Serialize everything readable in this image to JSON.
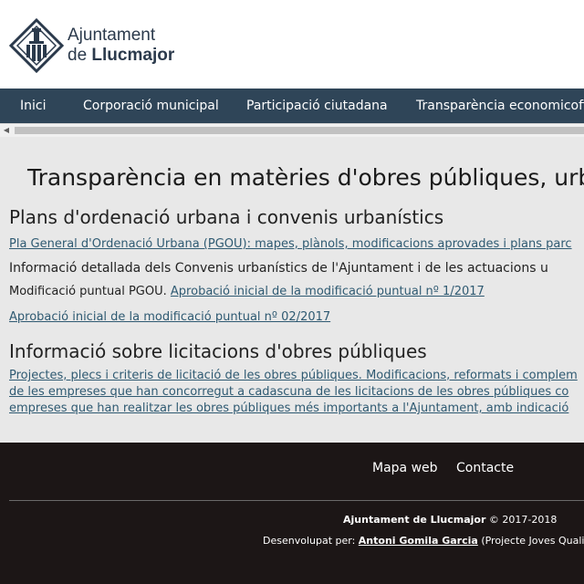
{
  "header": {
    "logo_line1": "Ajuntament",
    "logo_line2_prefix": "de ",
    "logo_line2_bold": "Llucmajor"
  },
  "nav": {
    "items": [
      {
        "label": "Inici"
      },
      {
        "label": "Corporació municipal"
      },
      {
        "label": "Participació ciutadana"
      },
      {
        "label": "Transparència economicofin"
      }
    ]
  },
  "main": {
    "page_title": "Transparència en matèries d'obres públiques, urb",
    "section1": {
      "title": "Plans d'ordenació urbana i convenis urbanístics",
      "link_pgou": "Pla General d'Ordenació Urbana (PGOU): mapes, plànols, modificacions aprovades i plans parc",
      "convenis_text": "Informació detallada dels Convenis urbanístics de l'Ajuntament i de les actuacions u",
      "mod_label": "Modificació puntual PGOU.",
      "mod_link_1": "Aprobació inicial de la modificació puntual nº 1/2017",
      "mod_link_2": "Aprobació inicial de la modificació puntual nº 02/2017"
    },
    "section2": {
      "title": "Informació sobre licitacions d'obres públiques",
      "line1": "Projectes, plecs i criteris de licitació de les obres públiques. Modificacions, reformats i complem",
      "line2": "de les empreses que han concorregut a cadascuna de les licitacions de les obres públiques co",
      "line3": "empreses que han realitzar les obres públiques més importants a l'Ajuntament, amb indicació"
    }
  },
  "footer": {
    "link_map": "Mapa web",
    "link_contact": "Contacte",
    "copy_name": "Ajuntament de Llucmajor",
    "copy_years": " © 2017-2018",
    "dev_prefix": "Desenvolupat per: ",
    "dev_name": "Antoni Gomila Garcia",
    "dev_suffix": " (Projecte Joves Qualificats"
  },
  "colors": {
    "nav_bg": "#2f4558",
    "footer_bg": "#1c1616",
    "link": "#2f5a72",
    "main_bg": "#e8e8e8"
  }
}
